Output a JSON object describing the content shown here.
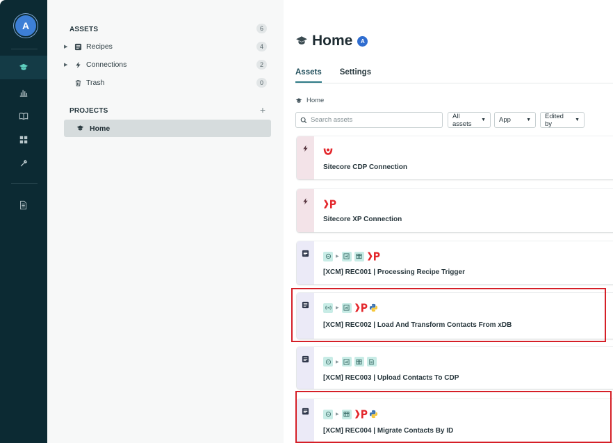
{
  "user": {
    "initial": "A"
  },
  "sidebar": {
    "assets_heading": "ASSETS",
    "assets_count": "6",
    "items": [
      {
        "label": "Recipes",
        "count": "4"
      },
      {
        "label": "Connections",
        "count": "2"
      },
      {
        "label": "Trash",
        "count": "0"
      }
    ],
    "projects_heading": "PROJECTS",
    "projects": [
      {
        "label": "Home"
      }
    ]
  },
  "main": {
    "title": "Home",
    "title_badge": "A",
    "tabs": [
      {
        "label": "Assets"
      },
      {
        "label": "Settings"
      }
    ],
    "breadcrumb": "Home",
    "search_placeholder": "Search assets",
    "filters": [
      {
        "label": "All assets"
      },
      {
        "label": "App"
      },
      {
        "label": "Edited by"
      }
    ],
    "cards": [
      {
        "kind": "connection",
        "name": "Sitecore CDP Connection"
      },
      {
        "kind": "connection",
        "name": "Sitecore XP Connection"
      },
      {
        "kind": "recipe",
        "name": "[XCM] REC001 | Processing Recipe Trigger"
      },
      {
        "kind": "recipe",
        "name": "[XCM] REC002 | Load And Transform Contacts From xDB"
      },
      {
        "kind": "recipe",
        "name": "[XCM] REC003 | Upload Contacts To CDP"
      },
      {
        "kind": "recipe",
        "name": "[XCM] REC004 | Migrate Contacts By ID"
      }
    ]
  },
  "colors": {
    "rail_bg": "#0c2a33",
    "accent_teal": "#2d7a86",
    "highlight_red": "#d51f27",
    "xp_red": "#e3262b"
  }
}
